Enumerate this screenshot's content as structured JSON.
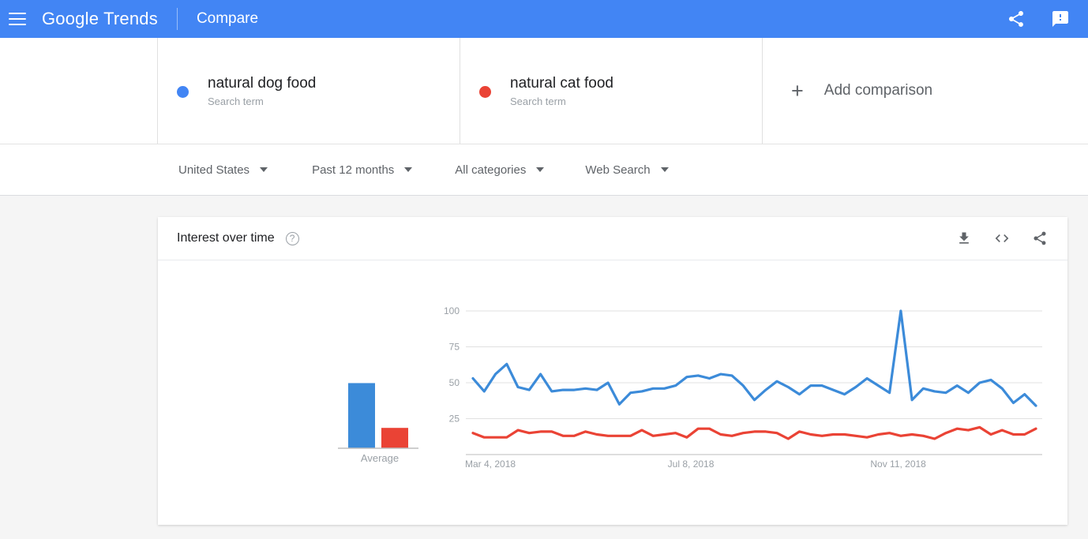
{
  "appbar": {
    "menu_icon": "hamburger-menu-icon",
    "brand_google": "Google",
    "brand_trends": "Trends",
    "compare_label": "Compare",
    "share_icon": "share-icon",
    "feedback_icon": "feedback-icon",
    "background_color": "#4285f4"
  },
  "comparison": {
    "items": [
      {
        "term": "natural dog food",
        "type": "Search term",
        "color": "#4285f4"
      },
      {
        "term": "natural cat food",
        "type": "Search term",
        "color": "#ea4335"
      }
    ],
    "add": {
      "label": "Add comparison",
      "plus": "+"
    }
  },
  "filters": [
    {
      "label": "United States",
      "name": "location-filter"
    },
    {
      "label": "Past 12 months",
      "name": "time-filter"
    },
    {
      "label": "All categories",
      "name": "category-filter"
    },
    {
      "label": "Web Search",
      "name": "search-type-filter"
    }
  ],
  "chart_card": {
    "title": "Interest over time",
    "help_icon": "help-icon",
    "download_icon": "download-icon",
    "embed_icon": "embed-code-icon",
    "share_icon": "share-icon"
  },
  "chart_data": {
    "type": "line",
    "title": "Interest over time",
    "xlabel": "",
    "ylabel": "",
    "ylim": [
      0,
      100
    ],
    "yticks": [
      25,
      50,
      75,
      100
    ],
    "grid": true,
    "legend_position": "top",
    "xticks": [
      "Mar 4, 2018",
      "Jul 8, 2018",
      "Nov 11, 2018"
    ],
    "xtick_positions": [
      0,
      18,
      36
    ],
    "series": [
      {
        "name": "natural dog food",
        "color": "#3c8bd9",
        "average": 48,
        "values": [
          53,
          44,
          56,
          63,
          47,
          45,
          56,
          44,
          45,
          45,
          46,
          45,
          50,
          35,
          43,
          44,
          46,
          46,
          48,
          54,
          55,
          53,
          56,
          55,
          48,
          38,
          45,
          51,
          47,
          42,
          48,
          48,
          45,
          42,
          47,
          53,
          48,
          43,
          100,
          38,
          46,
          44,
          43,
          48,
          43,
          50,
          52,
          46,
          36,
          42,
          34
        ]
      },
      {
        "name": "natural cat food",
        "color": "#ea4335",
        "average": 15,
        "values": [
          15,
          12,
          12,
          12,
          17,
          15,
          16,
          16,
          13,
          13,
          16,
          14,
          13,
          13,
          13,
          17,
          13,
          14,
          15,
          12,
          18,
          18,
          14,
          13,
          15,
          16,
          16,
          15,
          11,
          16,
          14,
          13,
          14,
          14,
          13,
          12,
          14,
          15,
          13,
          14,
          13,
          11,
          15,
          18,
          17,
          19,
          14,
          17,
          14,
          14,
          18
        ]
      }
    ],
    "average_panel": {
      "label": "Average",
      "bars": [
        {
          "name": "natural dog food",
          "value": 48,
          "color": "#3c8bd9"
        },
        {
          "name": "natural cat food",
          "value": 15,
          "color": "#ea4335"
        }
      ]
    }
  }
}
